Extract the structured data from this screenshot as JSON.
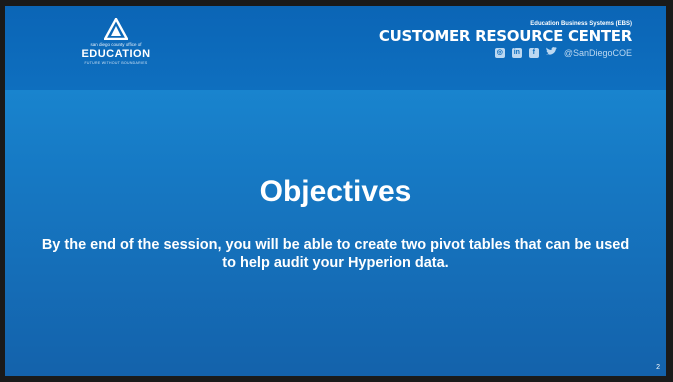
{
  "header": {
    "logo": {
      "line1": "san diego county office of",
      "line2": "EDUCATION",
      "tagline": "FUTURE WITHOUT BOUNDARIES"
    },
    "resource_center": {
      "subtitle": "Education Business Systems (EBS)",
      "title": "CUSTOMER RESOURCE CENTER",
      "social_icons": [
        "instagram-icon",
        "linkedin-icon",
        "facebook-icon",
        "twitter-icon"
      ],
      "handle": "@SanDiegoCOE"
    }
  },
  "slide": {
    "title": "Objectives",
    "body": "By the end of the session, you will be able to create two pivot tables that can be used to help audit your Hyperion data.",
    "page_number": "2"
  },
  "colors": {
    "header_blue": "#0e6fbf",
    "slide_blue": "#1679c4",
    "text": "#ffffff"
  }
}
